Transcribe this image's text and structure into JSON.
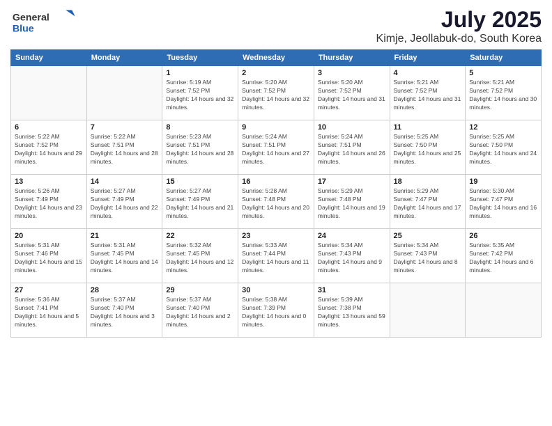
{
  "logo": {
    "general": "General",
    "blue": "Blue"
  },
  "header": {
    "title": "July 2025",
    "subtitle": "Kimje, Jeollabuk-do, South Korea"
  },
  "weekdays": [
    "Sunday",
    "Monday",
    "Tuesday",
    "Wednesday",
    "Thursday",
    "Friday",
    "Saturday"
  ],
  "weeks": [
    [
      {
        "day": "",
        "sunrise": "",
        "sunset": "",
        "daylight": ""
      },
      {
        "day": "",
        "sunrise": "",
        "sunset": "",
        "daylight": ""
      },
      {
        "day": "1",
        "sunrise": "Sunrise: 5:19 AM",
        "sunset": "Sunset: 7:52 PM",
        "daylight": "Daylight: 14 hours and 32 minutes."
      },
      {
        "day": "2",
        "sunrise": "Sunrise: 5:20 AM",
        "sunset": "Sunset: 7:52 PM",
        "daylight": "Daylight: 14 hours and 32 minutes."
      },
      {
        "day": "3",
        "sunrise": "Sunrise: 5:20 AM",
        "sunset": "Sunset: 7:52 PM",
        "daylight": "Daylight: 14 hours and 31 minutes."
      },
      {
        "day": "4",
        "sunrise": "Sunrise: 5:21 AM",
        "sunset": "Sunset: 7:52 PM",
        "daylight": "Daylight: 14 hours and 31 minutes."
      },
      {
        "day": "5",
        "sunrise": "Sunrise: 5:21 AM",
        "sunset": "Sunset: 7:52 PM",
        "daylight": "Daylight: 14 hours and 30 minutes."
      }
    ],
    [
      {
        "day": "6",
        "sunrise": "Sunrise: 5:22 AM",
        "sunset": "Sunset: 7:52 PM",
        "daylight": "Daylight: 14 hours and 29 minutes."
      },
      {
        "day": "7",
        "sunrise": "Sunrise: 5:22 AM",
        "sunset": "Sunset: 7:51 PM",
        "daylight": "Daylight: 14 hours and 28 minutes."
      },
      {
        "day": "8",
        "sunrise": "Sunrise: 5:23 AM",
        "sunset": "Sunset: 7:51 PM",
        "daylight": "Daylight: 14 hours and 28 minutes."
      },
      {
        "day": "9",
        "sunrise": "Sunrise: 5:24 AM",
        "sunset": "Sunset: 7:51 PM",
        "daylight": "Daylight: 14 hours and 27 minutes."
      },
      {
        "day": "10",
        "sunrise": "Sunrise: 5:24 AM",
        "sunset": "Sunset: 7:51 PM",
        "daylight": "Daylight: 14 hours and 26 minutes."
      },
      {
        "day": "11",
        "sunrise": "Sunrise: 5:25 AM",
        "sunset": "Sunset: 7:50 PM",
        "daylight": "Daylight: 14 hours and 25 minutes."
      },
      {
        "day": "12",
        "sunrise": "Sunrise: 5:25 AM",
        "sunset": "Sunset: 7:50 PM",
        "daylight": "Daylight: 14 hours and 24 minutes."
      }
    ],
    [
      {
        "day": "13",
        "sunrise": "Sunrise: 5:26 AM",
        "sunset": "Sunset: 7:49 PM",
        "daylight": "Daylight: 14 hours and 23 minutes."
      },
      {
        "day": "14",
        "sunrise": "Sunrise: 5:27 AM",
        "sunset": "Sunset: 7:49 PM",
        "daylight": "Daylight: 14 hours and 22 minutes."
      },
      {
        "day": "15",
        "sunrise": "Sunrise: 5:27 AM",
        "sunset": "Sunset: 7:49 PM",
        "daylight": "Daylight: 14 hours and 21 minutes."
      },
      {
        "day": "16",
        "sunrise": "Sunrise: 5:28 AM",
        "sunset": "Sunset: 7:48 PM",
        "daylight": "Daylight: 14 hours and 20 minutes."
      },
      {
        "day": "17",
        "sunrise": "Sunrise: 5:29 AM",
        "sunset": "Sunset: 7:48 PM",
        "daylight": "Daylight: 14 hours and 19 minutes."
      },
      {
        "day": "18",
        "sunrise": "Sunrise: 5:29 AM",
        "sunset": "Sunset: 7:47 PM",
        "daylight": "Daylight: 14 hours and 17 minutes."
      },
      {
        "day": "19",
        "sunrise": "Sunrise: 5:30 AM",
        "sunset": "Sunset: 7:47 PM",
        "daylight": "Daylight: 14 hours and 16 minutes."
      }
    ],
    [
      {
        "day": "20",
        "sunrise": "Sunrise: 5:31 AM",
        "sunset": "Sunset: 7:46 PM",
        "daylight": "Daylight: 14 hours and 15 minutes."
      },
      {
        "day": "21",
        "sunrise": "Sunrise: 5:31 AM",
        "sunset": "Sunset: 7:45 PM",
        "daylight": "Daylight: 14 hours and 14 minutes."
      },
      {
        "day": "22",
        "sunrise": "Sunrise: 5:32 AM",
        "sunset": "Sunset: 7:45 PM",
        "daylight": "Daylight: 14 hours and 12 minutes."
      },
      {
        "day": "23",
        "sunrise": "Sunrise: 5:33 AM",
        "sunset": "Sunset: 7:44 PM",
        "daylight": "Daylight: 14 hours and 11 minutes."
      },
      {
        "day": "24",
        "sunrise": "Sunrise: 5:34 AM",
        "sunset": "Sunset: 7:43 PM",
        "daylight": "Daylight: 14 hours and 9 minutes."
      },
      {
        "day": "25",
        "sunrise": "Sunrise: 5:34 AM",
        "sunset": "Sunset: 7:43 PM",
        "daylight": "Daylight: 14 hours and 8 minutes."
      },
      {
        "day": "26",
        "sunrise": "Sunrise: 5:35 AM",
        "sunset": "Sunset: 7:42 PM",
        "daylight": "Daylight: 14 hours and 6 minutes."
      }
    ],
    [
      {
        "day": "27",
        "sunrise": "Sunrise: 5:36 AM",
        "sunset": "Sunset: 7:41 PM",
        "daylight": "Daylight: 14 hours and 5 minutes."
      },
      {
        "day": "28",
        "sunrise": "Sunrise: 5:37 AM",
        "sunset": "Sunset: 7:40 PM",
        "daylight": "Daylight: 14 hours and 3 minutes."
      },
      {
        "day": "29",
        "sunrise": "Sunrise: 5:37 AM",
        "sunset": "Sunset: 7:40 PM",
        "daylight": "Daylight: 14 hours and 2 minutes."
      },
      {
        "day": "30",
        "sunrise": "Sunrise: 5:38 AM",
        "sunset": "Sunset: 7:39 PM",
        "daylight": "Daylight: 14 hours and 0 minutes."
      },
      {
        "day": "31",
        "sunrise": "Sunrise: 5:39 AM",
        "sunset": "Sunset: 7:38 PM",
        "daylight": "Daylight: 13 hours and 59 minutes."
      },
      {
        "day": "",
        "sunrise": "",
        "sunset": "",
        "daylight": ""
      },
      {
        "day": "",
        "sunrise": "",
        "sunset": "",
        "daylight": ""
      }
    ]
  ]
}
